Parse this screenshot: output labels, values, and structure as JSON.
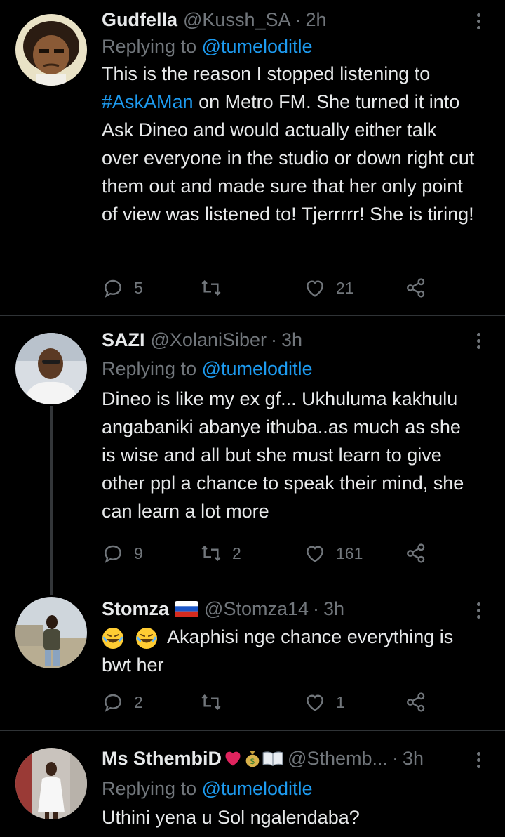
{
  "tweets": [
    {
      "name": "Gudfella",
      "handle": "@Kussh_SA",
      "time": "2h",
      "replying_prefix": "Replying to ",
      "replying_to": "@tumeloditle",
      "text_lines_pre": "This is the reason I stopped listening to",
      "hashtag": "#AskAMan",
      "text_rest": " on Metro FM. She turned it into Ask Dineo and would actually either talk over everyone in the studio or down right cut them out and made sure that her only point of view was listened to! Tjerrrrr! She is tiring!",
      "replies": "5",
      "retweets": "",
      "likes": "21"
    },
    {
      "name": "SAZI",
      "handle": "@XolaniSiber",
      "time": "3h",
      "replying_prefix": "Replying to ",
      "replying_to": "@tumeloditle",
      "text": "Dineo is like my ex gf... Ukhuluma kakhulu angabaniki abanye ithuba..as much as she is wise and all but she must learn to give other ppl a chance to speak their mind, she can learn a lot more",
      "replies": "9",
      "retweets": "2",
      "likes": "161"
    },
    {
      "name": "Stomza",
      "handle": "@Stomza14",
      "time": "3h",
      "text": "Akaphisi nge chance everything is bwt her",
      "replies": "2",
      "retweets": "",
      "likes": "1"
    },
    {
      "name": "Ms SthembiD",
      "handle": "@Sthemb...",
      "time": "3h",
      "replying_prefix": "Replying to ",
      "replying_to": "@tumeloditle",
      "text": "Uthini yena u Sol ngalendaba?"
    }
  ],
  "separator": "·",
  "colors": {
    "accent": "#1d9bf0",
    "muted": "#71767b",
    "text": "#e7e9ea",
    "background": "#000000"
  }
}
